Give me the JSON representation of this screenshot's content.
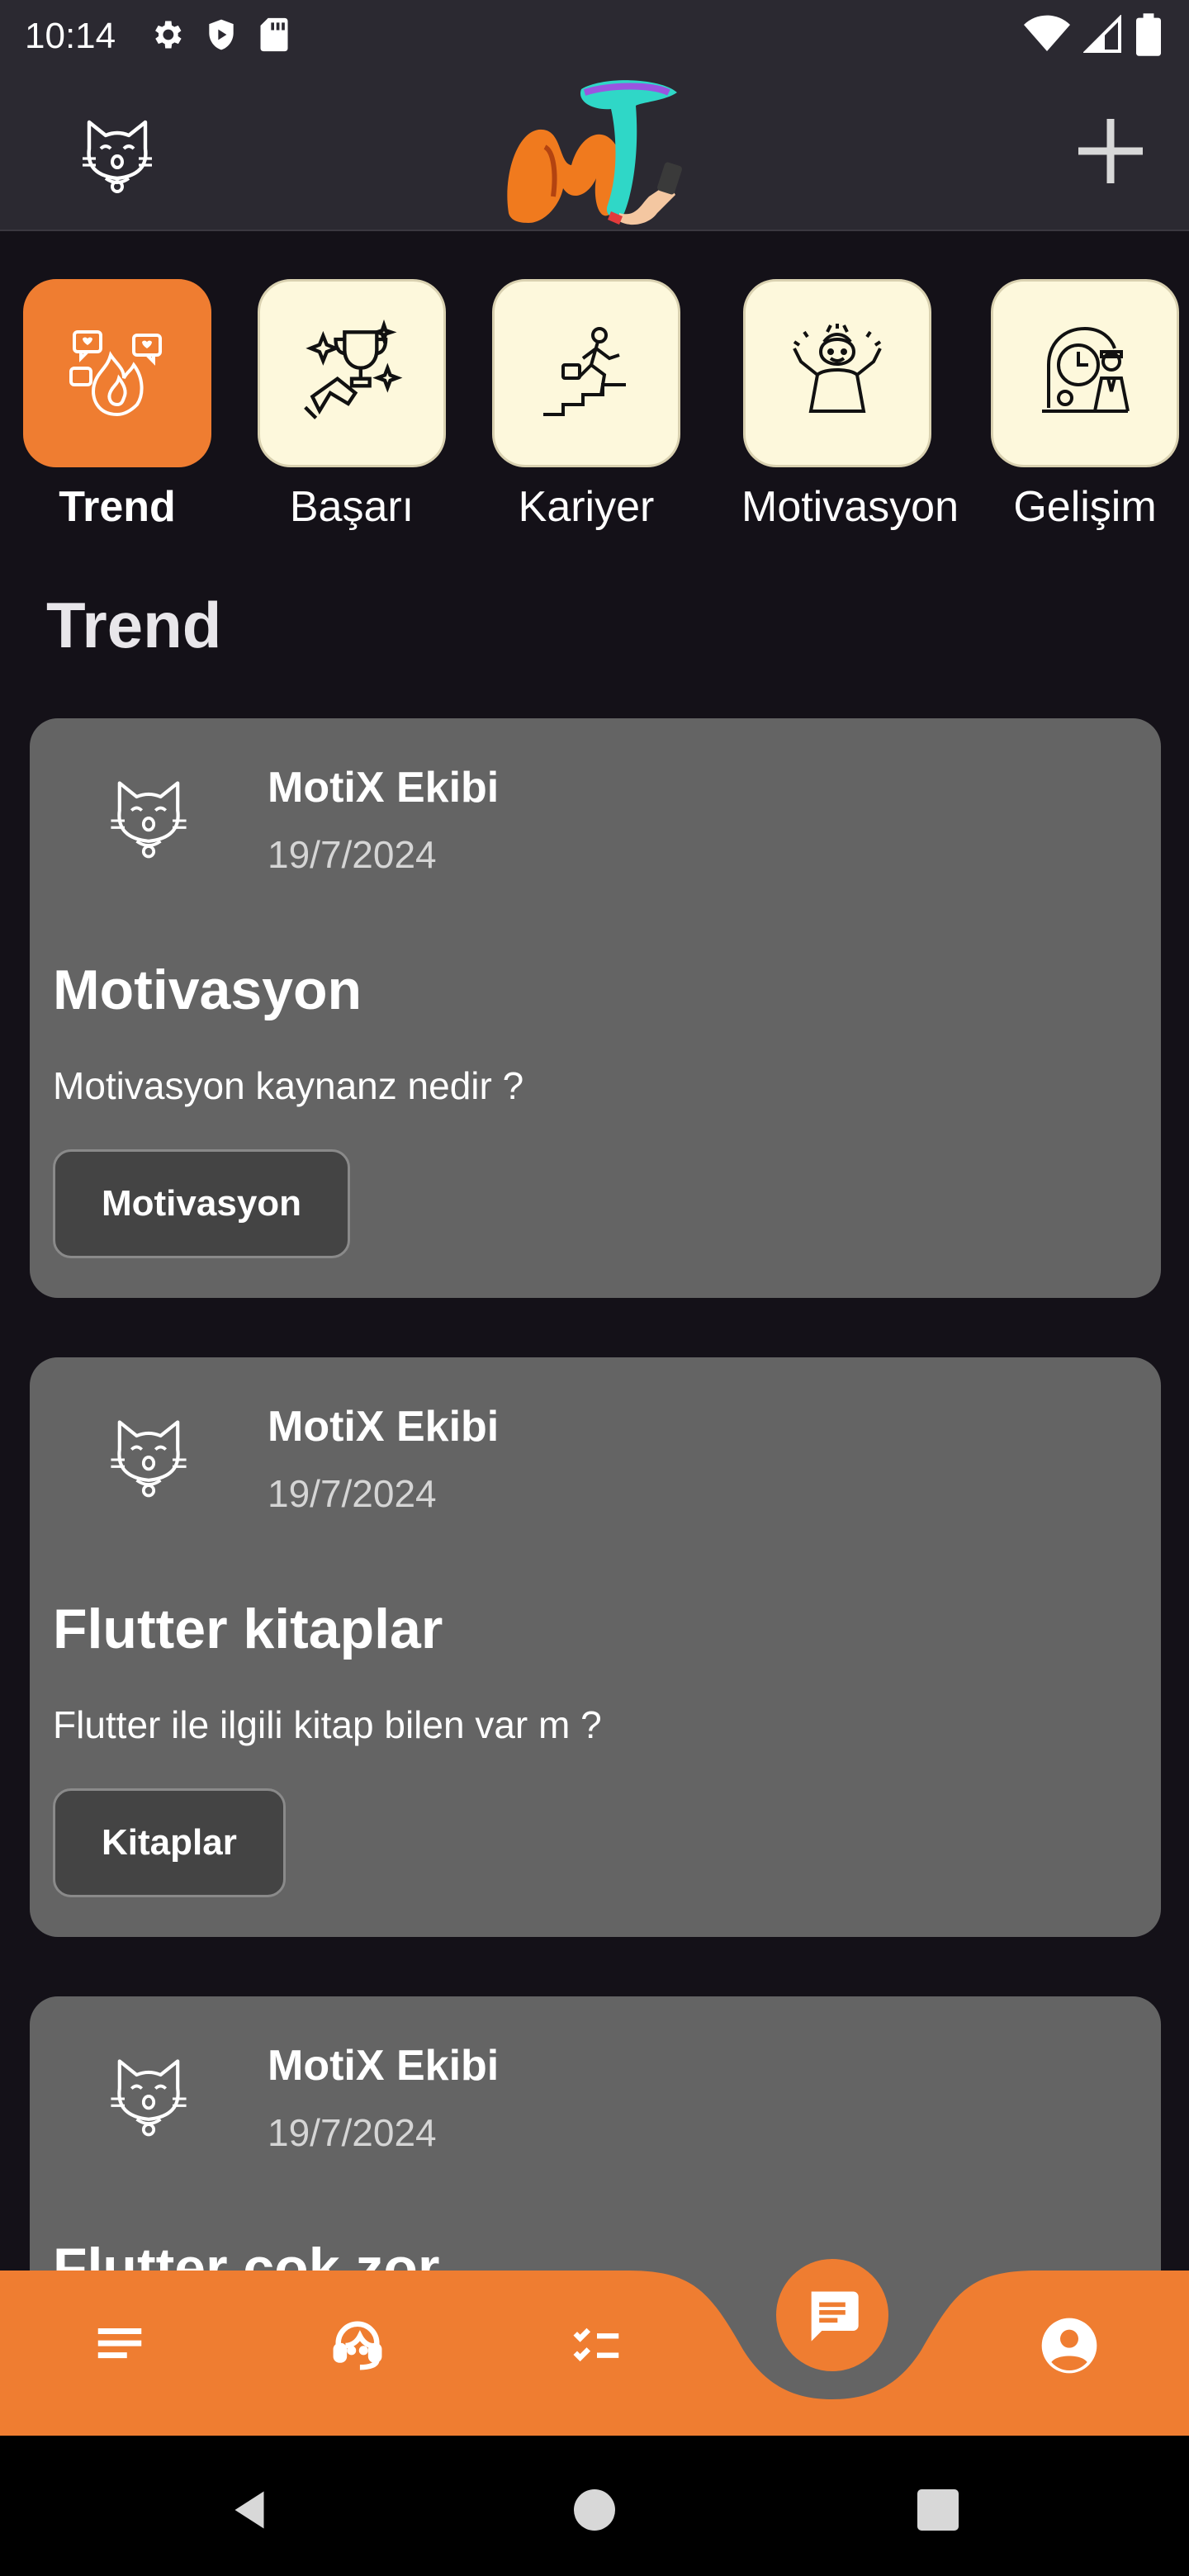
{
  "status_bar": {
    "time": "10:14",
    "left_icons": [
      "gear-icon",
      "shield-icon",
      "sd-card-icon"
    ],
    "right_icons": [
      "wifi-icon",
      "cell-signal-icon",
      "battery-icon"
    ]
  },
  "app_bar": {
    "avatar_icon": "cat-avatar-icon",
    "logo_icon": "motix-logo",
    "add_icon": "plus-icon"
  },
  "categories": [
    {
      "label": "Trend",
      "icon": "trend-chat-fire-icon",
      "active": true
    },
    {
      "label": "Başarı",
      "icon": "trophy-icon",
      "active": false
    },
    {
      "label": "Kariyer",
      "icon": "career-stairs-icon",
      "active": false
    },
    {
      "label": "Motivasyon",
      "icon": "motivated-person-icon",
      "active": false
    },
    {
      "label": "Gelişim",
      "icon": "development-clock-icon",
      "active": false
    }
  ],
  "section_title": "Trend",
  "posts": [
    {
      "author": "MotiX Ekibi",
      "date": "19/7/2024",
      "title": "Motivasyon",
      "body": "Motivasyon kaynanz nedir ?",
      "tag": "Motivasyon"
    },
    {
      "author": "MotiX Ekibi",
      "date": "19/7/2024",
      "title": "Flutter kitaplar",
      "body": "Flutter ile ilgili kitap bilen var m ?",
      "tag": "Kitaplar"
    },
    {
      "author": "MotiX Ekibi",
      "date": "19/7/2024",
      "title": "Flutter çok zor",
      "body": "",
      "tag": ""
    }
  ],
  "bottom_nav": {
    "items": [
      "menu-lines-icon",
      "support-agent-icon",
      "checklist-icon",
      "chat-icon",
      "account-circle-icon"
    ],
    "active": "chat-icon"
  },
  "system_nav": [
    "back-triangle-icon",
    "home-circle-icon",
    "recents-square-icon"
  ],
  "colors": {
    "accent": "#ef7d31",
    "background": "#141118",
    "app_bar": "#2b2931",
    "card": "#646464",
    "category_tile": "#fdf8dc"
  }
}
